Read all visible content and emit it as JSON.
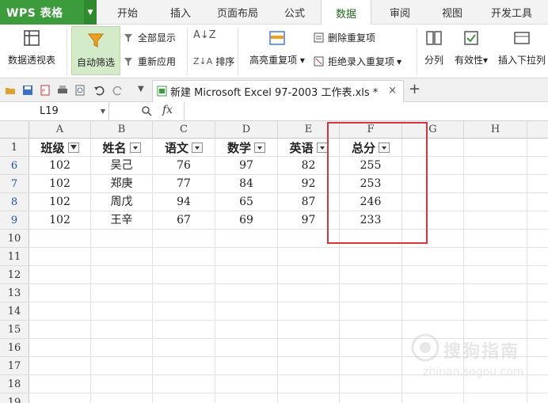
{
  "app": {
    "name": "WPS 表格"
  },
  "menu_tabs": [
    "开始",
    "插入",
    "页面布局",
    "公式",
    "数据",
    "审阅",
    "视图",
    "开发工具"
  ],
  "ribbon": {
    "pivot": "数据透视表",
    "autofilter": "自动筛选",
    "show_all": "全部显示",
    "reapply": "重新应用",
    "sort": "排序",
    "highlight_dup": "高亮重复项",
    "remove_dup": "删除重复项",
    "reject_dup": "拒绝录入重复项",
    "split": "分列",
    "validity": "有效性",
    "insert_dropdown": "插入下拉列"
  },
  "document_tab": {
    "title": "新建 Microsoft Excel 97-2003 工作表.xls *",
    "close": "×",
    "new": "+"
  },
  "formula_bar": {
    "name_box": "L19",
    "fx": "fx",
    "value": ""
  },
  "sheet": {
    "columns": [
      "A",
      "B",
      "C",
      "D",
      "E",
      "F",
      "G",
      "H"
    ],
    "headers": [
      "班级",
      "姓名",
      "语文",
      "数学",
      "英语",
      "总分"
    ],
    "rows": [
      {
        "num": "6",
        "cells": [
          "102",
          "吴己",
          "76",
          "97",
          "82",
          "255"
        ]
      },
      {
        "num": "7",
        "cells": [
          "102",
          "郑庚",
          "77",
          "84",
          "92",
          "253"
        ]
      },
      {
        "num": "8",
        "cells": [
          "102",
          "周戊",
          "94",
          "65",
          "87",
          "246"
        ]
      },
      {
        "num": "9",
        "cells": [
          "102",
          "王辛",
          "67",
          "69",
          "97",
          "233"
        ]
      }
    ],
    "empty_rows": [
      "10",
      "11",
      "12",
      "13",
      "14",
      "15",
      "16",
      "17",
      "18",
      "19"
    ]
  },
  "watermark": {
    "text": "搜狗指南",
    "sub": "zhinan.sogou.com"
  },
  "colors": {
    "brand_green": "#3c9c3c",
    "highlight_red": "#d9333c",
    "filtered_row": "#1b4fb3"
  }
}
